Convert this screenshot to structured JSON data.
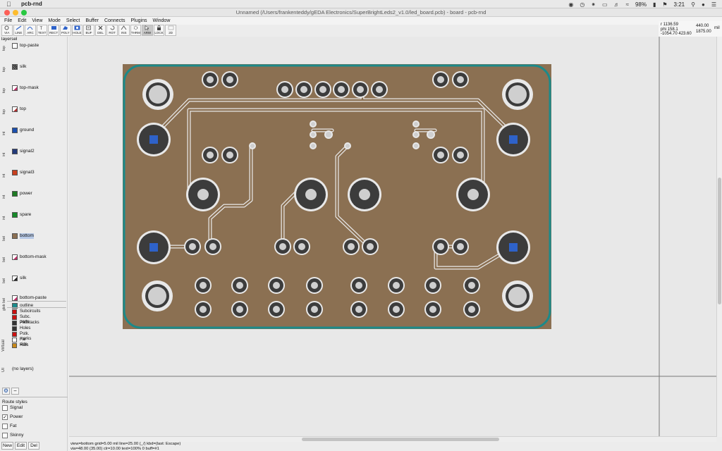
{
  "macbar": {
    "app_name": "pcb-rnd",
    "battery": "98%",
    "time": "3:21"
  },
  "window": {
    "title": "Unnamed (/Users/frankenteddy/gEDA Electronics/SuperBrightLeds2_v1.0/led_board.pcb) - board - pcb-rnd"
  },
  "menu": [
    "File",
    "Edit",
    "View",
    "Mode",
    "Select",
    "Buffer",
    "Connects",
    "Plugins",
    "Window"
  ],
  "toolbar": [
    {
      "label": "VIA",
      "icon": "via-icon"
    },
    {
      "label": "LINE",
      "icon": "line-icon"
    },
    {
      "label": "ARC",
      "icon": "arc-icon"
    },
    {
      "label": "TEXT",
      "icon": "text-icon"
    },
    {
      "label": "RECT",
      "icon": "rect-icon"
    },
    {
      "label": "POLY",
      "icon": "poly-icon"
    },
    {
      "label": "HOLE",
      "icon": "hole-icon"
    },
    {
      "label": "BUF",
      "icon": "buffer-icon"
    },
    {
      "label": "DEL",
      "icon": "delete-icon"
    },
    {
      "label": "ROT",
      "icon": "rotate-icon"
    },
    {
      "label": "INS",
      "icon": "insert-icon"
    },
    {
      "label": "THRM",
      "icon": "thermal-icon"
    },
    {
      "label": "ARW",
      "icon": "arrow-icon"
    },
    {
      "label": "LOCK",
      "icon": "lock-icon"
    },
    {
      "label": "2D",
      "icon": "2d-icon"
    }
  ],
  "readout": {
    "r": "r 1136.59",
    "phi": "phi 158.1",
    "delta": "-1054.70 423.60",
    "x": "440.00",
    "y": "1875.00",
    "unit": "mil"
  },
  "sidebar": {
    "layersel_label": "layersel",
    "layers": [
      {
        "group": "top",
        "name": "top-paste",
        "color": "#ffffff",
        "stripe": "#c0306a"
      },
      {
        "group": "top",
        "name": "silk",
        "color": "#222222",
        "stripe": "#222222"
      },
      {
        "group": "top",
        "name": "top-mask",
        "color": "#ffffff",
        "stripe": "#c0306a"
      },
      {
        "group": "top",
        "name": "top",
        "color": "#ffffff",
        "stripe": "#b03030"
      },
      {
        "group": "int",
        "name": "ground",
        "color": "#1b4fae",
        "stripe": "#1b4fae"
      },
      {
        "group": "int",
        "name": "signal2",
        "color": "#233a7a",
        "stripe": "#233a7a"
      },
      {
        "group": "int",
        "name": "signal3",
        "color": "#c8401f",
        "stripe": "#c8401f"
      },
      {
        "group": "int",
        "name": "power",
        "color": "#1e7a24",
        "stripe": "#1e7a24"
      },
      {
        "group": "int",
        "name": "spare",
        "color": "#178a2a",
        "stripe": "#178a2a"
      },
      {
        "group": "bot",
        "name": "bottom",
        "color": "#8b7052",
        "stripe": "#8b7052"
      },
      {
        "group": "bot",
        "name": "bottom-mask",
        "color": "#ffffff",
        "stripe": "#c0306a"
      },
      {
        "group": "bot",
        "name": "silk",
        "color": "#ffffff",
        "stripe": "#222222"
      },
      {
        "group": "bot",
        "name": "bottom-paste",
        "color": "#ffffff",
        "stripe": "#c0306a"
      }
    ],
    "outline": {
      "group": "glob",
      "name": "outline",
      "color": "#1b8a8a"
    },
    "virtual_label": "Virtual",
    "virtual": [
      {
        "name": "Subcircuits",
        "color": "#cc1111"
      },
      {
        "name": "Subc. parts",
        "color": "#cc1111"
      },
      {
        "name": "Padstacks",
        "color": "#333333"
      },
      {
        "name": "Holes",
        "color": "#333333"
      },
      {
        "name": "Pstk. marks",
        "color": "#cc1111"
      },
      {
        "name": "Far side",
        "color": "#ffffff"
      },
      {
        "name": "Rats",
        "color": "#c8891a"
      }
    ],
    "ui_label": "UI",
    "no_layers": "(no layers)",
    "route_styles_label": "Route styles",
    "route_styles": [
      {
        "name": "Signal",
        "checked": false
      },
      {
        "name": "Power",
        "checked": true
      },
      {
        "name": "Fat",
        "checked": false
      },
      {
        "name": "Skinny",
        "checked": false
      }
    ],
    "buttons": {
      "new": "New",
      "edit": "Edit",
      "del": "Del"
    }
  },
  "status": {
    "line1": "view=bottom  grid=5.00 mil  line=25.00 (_/) kbd=(last: Escape)",
    "line2": "via=48.00 (35.00)  clr=10.00  text=100% 0 buff=#1"
  },
  "colors": {
    "board": "#8b7052",
    "outline": "#1b8a8a",
    "trace": "#e8e8e8",
    "pad_dark": "#3c3c3c",
    "pad_light": "#cfcfcf",
    "accent_blue": "#2e62c9"
  }
}
